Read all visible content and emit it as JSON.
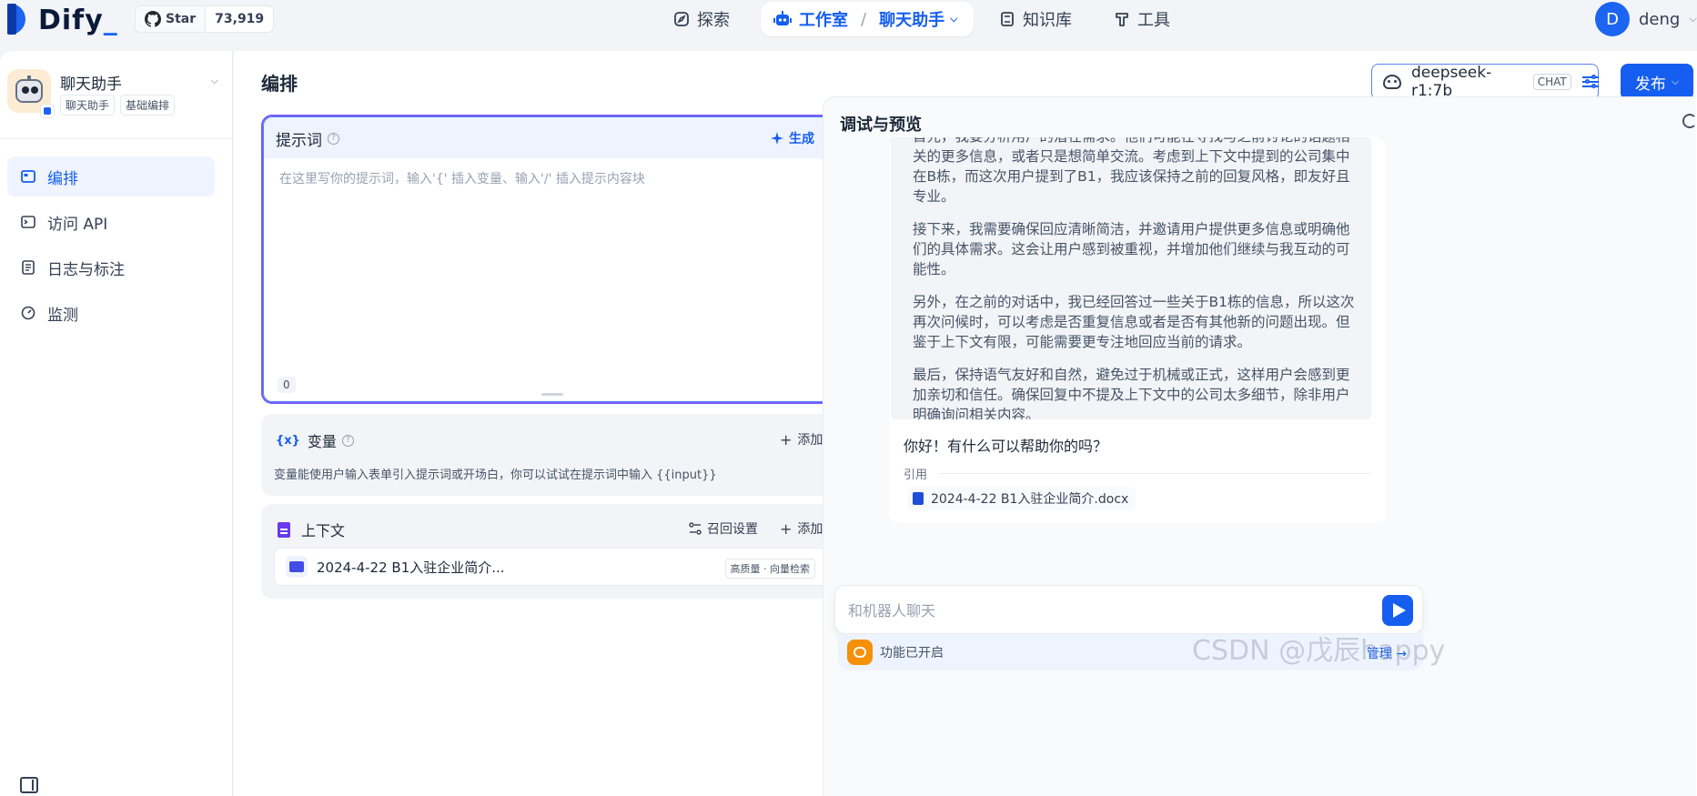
{
  "brand": {
    "name": "Dify",
    "cursor": "_"
  },
  "github": {
    "star_label": "Star",
    "star_count": "73,919"
  },
  "nav": {
    "explore": "探索",
    "studio": "工作室",
    "current_app": "聊天助手",
    "knowledge": "知识库",
    "tools": "工具"
  },
  "user": {
    "initial": "D",
    "name": "deng"
  },
  "app": {
    "name": "聊天助手",
    "tags": [
      "聊天助手",
      "基础编排"
    ]
  },
  "sidebar": {
    "items": [
      {
        "label": "编排",
        "icon": "layout-icon",
        "active": true
      },
      {
        "label": "访问 API",
        "icon": "terminal-icon",
        "active": false
      },
      {
        "label": "日志与标注",
        "icon": "file-list-icon",
        "active": false
      },
      {
        "label": "监测",
        "icon": "gauge-icon",
        "active": false
      }
    ]
  },
  "page": {
    "title": "编排"
  },
  "model": {
    "name": "deepseek-r1:7b",
    "mode": "CHAT"
  },
  "publish": {
    "label": "发布"
  },
  "prompt": {
    "title": "提示词",
    "generate_label": "生成",
    "placeholder": "在这里写你的提示词，输入'{' 插入变量、输入'/' 插入提示内容块",
    "char_count": "0"
  },
  "variables": {
    "title": "变量",
    "add_label": "添加",
    "description": "变量能使用户输入表单引入提示词或开场白，你可以试试在提示词中输入 {{input}}"
  },
  "context": {
    "title": "上下文",
    "recall_label": "召回设置",
    "add_label": "添加",
    "dataset_name": "2024-4-22 B1入驻企业简介...",
    "dataset_tag": "高质量 · 向量检索"
  },
  "debug": {
    "title": "调试与预览",
    "thinking": [
      "首先，我要分析用户的潜在需求。他们可能在寻找与之前讨论的话题相关的更多信息，或者只是想简单交流。考虑到上下文中提到的公司集中在B栋，而这次用户提到了B1，我应该保持之前的回复风格，即友好且专业。",
      "接下来，我需要确保回应清晰简洁，并邀请用户提供更多信息或明确他们的具体需求。这会让用户感到被重视，并增加他们继续与我互动的可能性。",
      "另外，在之前的对话中，我已经回答过一些关于B1栋的信息，所以这次再次问候时，可以考虑是否重复信息或者是否有其他新的问题出现。但鉴于上下文有限，可能需要更专注地回应当前的请求。",
      "最后，保持语气友好和自然，避免过于机械或正式，这样用户会感到更加亲切和信任。确保回复中不提及上下文中的公司太多细节，除非用户明确询问相关内容。"
    ],
    "answer": "你好！有什么可以帮助你的吗？",
    "citation_label": "引用",
    "citation_doc": "2024-4-22 B1入驻企业简介.docx",
    "input_placeholder": "和机器人聊天",
    "feature_text": "功能已开启",
    "manage_label": "管理"
  },
  "watermark": "CSDN @戊辰happy",
  "colors": {
    "accent": "#155eef",
    "brand_dark": "#0b3aa8",
    "feature_orange": "#f79009"
  }
}
